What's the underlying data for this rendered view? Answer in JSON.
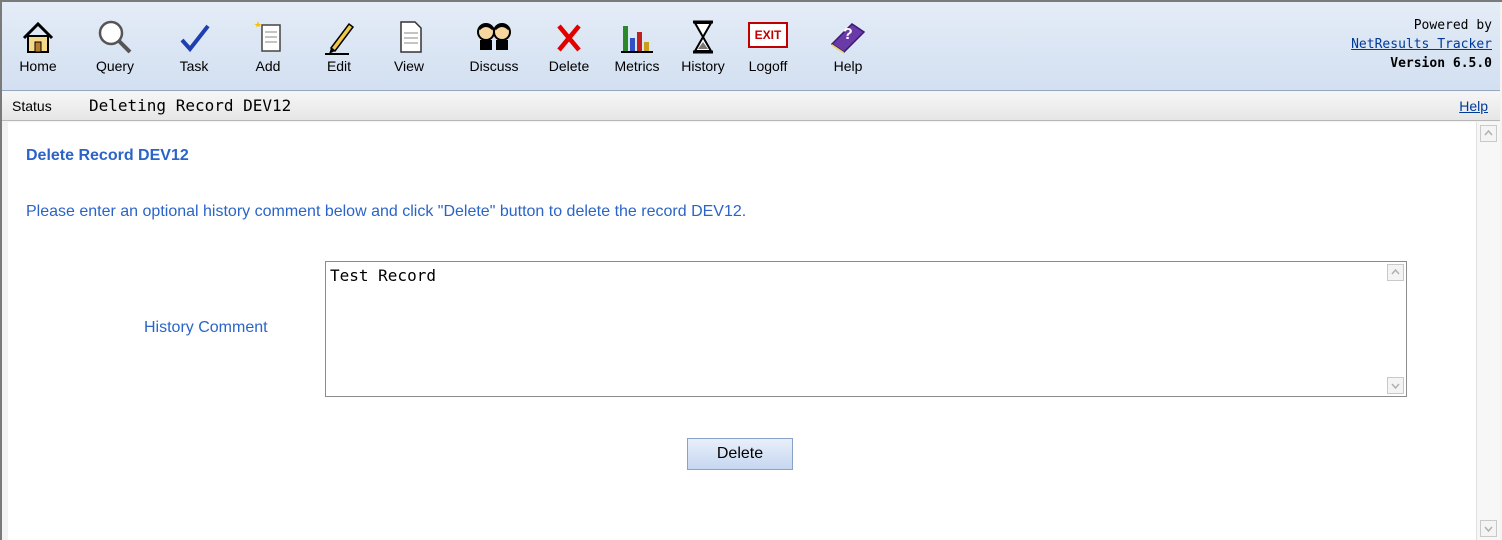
{
  "toolbar": {
    "items": [
      {
        "label": "Home",
        "icon": "home-icon"
      },
      {
        "label": "Query",
        "icon": "magnifier-icon"
      },
      {
        "label": "Task",
        "icon": "checkmark-icon"
      },
      {
        "label": "Add",
        "icon": "new-document-icon"
      },
      {
        "label": "Edit",
        "icon": "pencil-icon"
      },
      {
        "label": "View",
        "icon": "document-icon"
      },
      {
        "label": "Discuss",
        "icon": "people-icon"
      },
      {
        "label": "Delete",
        "icon": "red-x-icon"
      },
      {
        "label": "Metrics",
        "icon": "bar-chart-icon"
      },
      {
        "label": "History",
        "icon": "hourglass-icon"
      },
      {
        "label": "Logoff",
        "icon": "exit-sign-icon"
      },
      {
        "label": "Help",
        "icon": "help-book-icon"
      }
    ],
    "exit_text": "EXIT",
    "help_text": "?"
  },
  "branding": {
    "powered_by": "Powered by",
    "product_link": "NetResults Tracker",
    "version": "Version 6.5.0"
  },
  "status": {
    "label": "Status",
    "text": "Deleting Record DEV12",
    "help_link": "Help"
  },
  "main": {
    "title": "Delete Record DEV12",
    "instruction": "Please enter an optional history comment below and click \"Delete\" button to delete the record DEV12.",
    "history_label": "History Comment",
    "history_value": "Test Record",
    "delete_button": "Delete"
  },
  "colors": {
    "accent_text": "#2a64c8",
    "toolbar_bg": "#d8e4f3"
  }
}
